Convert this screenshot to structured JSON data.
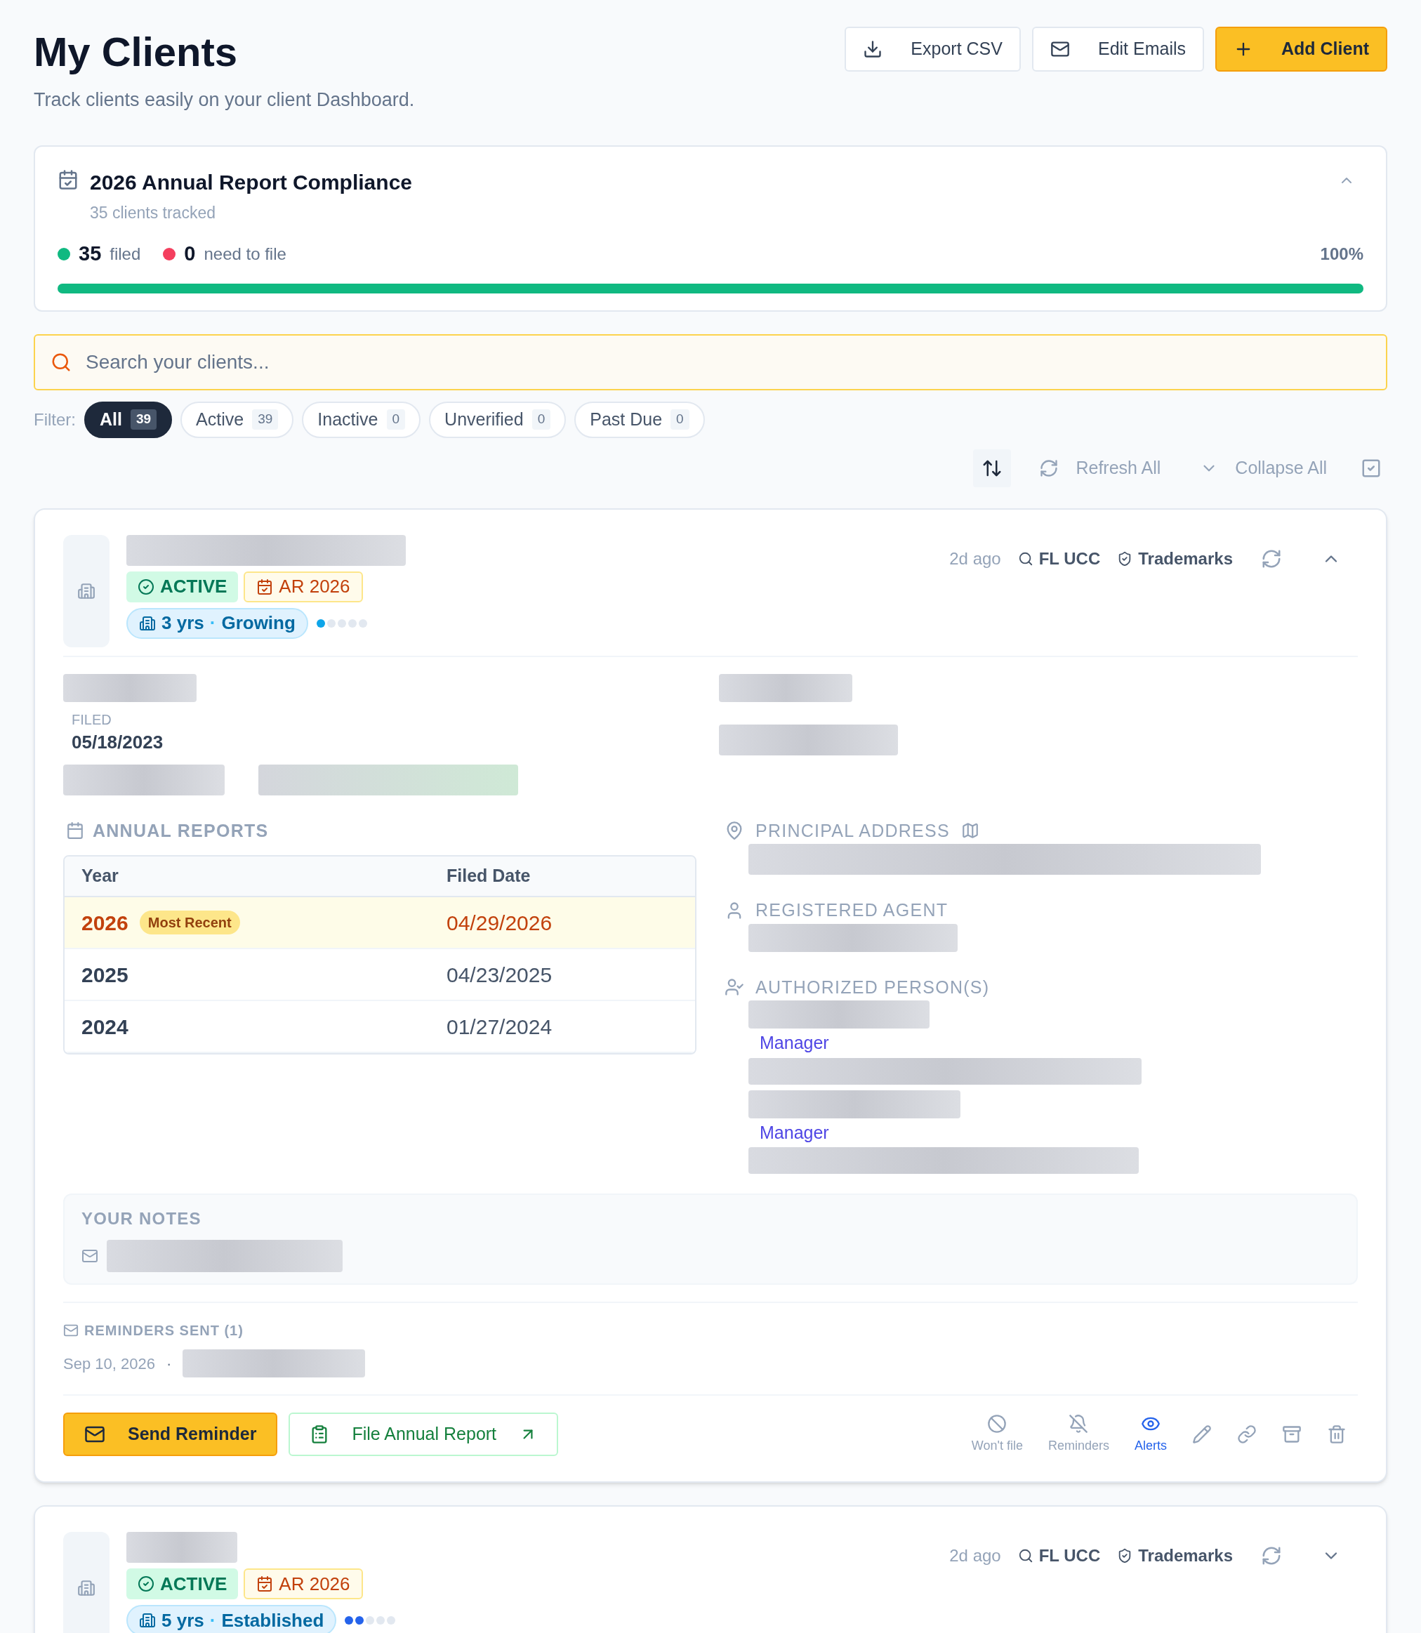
{
  "header": {
    "title": "My Clients",
    "subtitle": "Track clients easily on your client Dashboard.",
    "buttons": [
      {
        "label": "Export CSV",
        "kind": "export"
      },
      {
        "label": "Edit Emails",
        "kind": "email"
      },
      {
        "label": "Add Client",
        "kind": "add"
      }
    ]
  },
  "compliance": {
    "title": "2026 Annual Report Compliance",
    "subtitle": "35 clients tracked",
    "expanded": true,
    "stats": [
      {
        "count": "35",
        "label": "filed",
        "color": "#10b981"
      },
      {
        "count": "0",
        "label": "need to file",
        "color": "#f43f5e"
      }
    ],
    "percent": "100%",
    "level": 1
  },
  "search": {
    "placeholder": "Search your clients..."
  },
  "filter": {
    "label": "Filter:",
    "chips": [
      {
        "label": "All",
        "count": "39",
        "selected": true
      },
      {
        "label": "Active",
        "count": "39",
        "selected": false
      },
      {
        "label": "Inactive",
        "count": "0",
        "selected": false
      },
      {
        "label": "Unverified",
        "count": "0",
        "selected": false
      },
      {
        "label": "Past Due",
        "count": "0",
        "selected": false
      }
    ]
  },
  "toolbar": {
    "actions": [
      {
        "label": "Refresh All",
        "kind": "refresh"
      },
      {
        "label": "Collapse All",
        "kind": "collapse"
      }
    ]
  },
  "clients": [
    {
      "expanded": true,
      "updated": "2d ago",
      "links": [
        "FL UCC",
        "Trademarks"
      ],
      "badges": [
        {
          "label": "ACTIVE",
          "kind": "status"
        },
        {
          "label": "AR 2026",
          "kind": "report"
        }
      ],
      "age": "3 yrs",
      "separator": "·",
      "stage": "Growing",
      "level": 0.2,
      "filed": {
        "label": "FILED",
        "value": "05/18/2023"
      },
      "reports": {
        "title": "ANNUAL REPORTS",
        "columns": [
          "Year",
          "Filed Date"
        ],
        "rows": [
          {
            "year": "2026",
            "badge": "Most Recent",
            "date": "04/29/2026",
            "highlighted": true
          },
          {
            "year": "2025",
            "date": "04/23/2025",
            "highlighted": false
          },
          {
            "year": "2024",
            "date": "01/27/2024",
            "highlighted": false
          }
        ]
      },
      "sections": [
        {
          "kind": "address",
          "title": "PRINCIPAL ADDRESS"
        },
        {
          "kind": "agent",
          "title": "REGISTERED AGENT"
        },
        {
          "kind": "persons",
          "title": "AUTHORIZED PERSON(S)",
          "roles": [
            "Manager",
            "Manager"
          ]
        }
      ],
      "notes": {
        "title": "YOUR NOTES"
      },
      "reminders": {
        "title": "REMINDERS SENT (1)",
        "date": "Sep 10, 2026",
        "separator": "·"
      },
      "buttons": [
        {
          "label": "Send Reminder",
          "kind": "reminder"
        },
        {
          "label": "File Annual Report",
          "kind": "file"
        }
      ],
      "actions": [
        {
          "label": "Won't file",
          "kind": "wont",
          "active": false
        },
        {
          "label": "Reminders",
          "kind": "reminders",
          "active": false
        },
        {
          "label": "Alerts",
          "kind": "alerts",
          "active": true
        },
        {
          "kind": "edit"
        },
        {
          "kind": "link"
        },
        {
          "kind": "archive"
        },
        {
          "kind": "delete"
        }
      ]
    },
    {
      "expanded": false,
      "updated": "2d ago",
      "links": [
        "FL UCC",
        "Trademarks"
      ],
      "badges": [
        {
          "label": "ACTIVE",
          "kind": "status"
        },
        {
          "label": "AR 2026",
          "kind": "report"
        }
      ],
      "age": "5 yrs",
      "separator": "·",
      "stage": "Established",
      "level": 0.4
    }
  ]
}
